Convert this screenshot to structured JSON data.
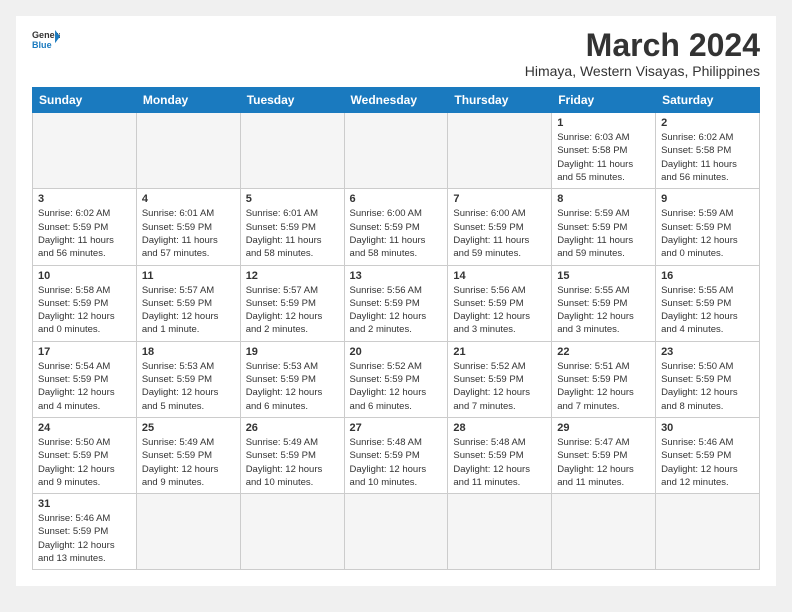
{
  "header": {
    "logo_general": "General",
    "logo_blue": "Blue",
    "title": "March 2024",
    "subtitle": "Himaya, Western Visayas, Philippines"
  },
  "weekdays": [
    "Sunday",
    "Monday",
    "Tuesday",
    "Wednesday",
    "Thursday",
    "Friday",
    "Saturday"
  ],
  "weeks": [
    [
      {
        "day": "",
        "info": ""
      },
      {
        "day": "",
        "info": ""
      },
      {
        "day": "",
        "info": ""
      },
      {
        "day": "",
        "info": ""
      },
      {
        "day": "",
        "info": ""
      },
      {
        "day": "1",
        "info": "Sunrise: 6:03 AM\nSunset: 5:58 PM\nDaylight: 11 hours\nand 55 minutes."
      },
      {
        "day": "2",
        "info": "Sunrise: 6:02 AM\nSunset: 5:58 PM\nDaylight: 11 hours\nand 56 minutes."
      }
    ],
    [
      {
        "day": "3",
        "info": "Sunrise: 6:02 AM\nSunset: 5:59 PM\nDaylight: 11 hours\nand 56 minutes."
      },
      {
        "day": "4",
        "info": "Sunrise: 6:01 AM\nSunset: 5:59 PM\nDaylight: 11 hours\nand 57 minutes."
      },
      {
        "day": "5",
        "info": "Sunrise: 6:01 AM\nSunset: 5:59 PM\nDaylight: 11 hours\nand 58 minutes."
      },
      {
        "day": "6",
        "info": "Sunrise: 6:00 AM\nSunset: 5:59 PM\nDaylight: 11 hours\nand 58 minutes."
      },
      {
        "day": "7",
        "info": "Sunrise: 6:00 AM\nSunset: 5:59 PM\nDaylight: 11 hours\nand 59 minutes."
      },
      {
        "day": "8",
        "info": "Sunrise: 5:59 AM\nSunset: 5:59 PM\nDaylight: 11 hours\nand 59 minutes."
      },
      {
        "day": "9",
        "info": "Sunrise: 5:59 AM\nSunset: 5:59 PM\nDaylight: 12 hours\nand 0 minutes."
      }
    ],
    [
      {
        "day": "10",
        "info": "Sunrise: 5:58 AM\nSunset: 5:59 PM\nDaylight: 12 hours\nand 0 minutes."
      },
      {
        "day": "11",
        "info": "Sunrise: 5:57 AM\nSunset: 5:59 PM\nDaylight: 12 hours\nand 1 minute."
      },
      {
        "day": "12",
        "info": "Sunrise: 5:57 AM\nSunset: 5:59 PM\nDaylight: 12 hours\nand 2 minutes."
      },
      {
        "day": "13",
        "info": "Sunrise: 5:56 AM\nSunset: 5:59 PM\nDaylight: 12 hours\nand 2 minutes."
      },
      {
        "day": "14",
        "info": "Sunrise: 5:56 AM\nSunset: 5:59 PM\nDaylight: 12 hours\nand 3 minutes."
      },
      {
        "day": "15",
        "info": "Sunrise: 5:55 AM\nSunset: 5:59 PM\nDaylight: 12 hours\nand 3 minutes."
      },
      {
        "day": "16",
        "info": "Sunrise: 5:55 AM\nSunset: 5:59 PM\nDaylight: 12 hours\nand 4 minutes."
      }
    ],
    [
      {
        "day": "17",
        "info": "Sunrise: 5:54 AM\nSunset: 5:59 PM\nDaylight: 12 hours\nand 4 minutes."
      },
      {
        "day": "18",
        "info": "Sunrise: 5:53 AM\nSunset: 5:59 PM\nDaylight: 12 hours\nand 5 minutes."
      },
      {
        "day": "19",
        "info": "Sunrise: 5:53 AM\nSunset: 5:59 PM\nDaylight: 12 hours\nand 6 minutes."
      },
      {
        "day": "20",
        "info": "Sunrise: 5:52 AM\nSunset: 5:59 PM\nDaylight: 12 hours\nand 6 minutes."
      },
      {
        "day": "21",
        "info": "Sunrise: 5:52 AM\nSunset: 5:59 PM\nDaylight: 12 hours\nand 7 minutes."
      },
      {
        "day": "22",
        "info": "Sunrise: 5:51 AM\nSunset: 5:59 PM\nDaylight: 12 hours\nand 7 minutes."
      },
      {
        "day": "23",
        "info": "Sunrise: 5:50 AM\nSunset: 5:59 PM\nDaylight: 12 hours\nand 8 minutes."
      }
    ],
    [
      {
        "day": "24",
        "info": "Sunrise: 5:50 AM\nSunset: 5:59 PM\nDaylight: 12 hours\nand 9 minutes."
      },
      {
        "day": "25",
        "info": "Sunrise: 5:49 AM\nSunset: 5:59 PM\nDaylight: 12 hours\nand 9 minutes."
      },
      {
        "day": "26",
        "info": "Sunrise: 5:49 AM\nSunset: 5:59 PM\nDaylight: 12 hours\nand 10 minutes."
      },
      {
        "day": "27",
        "info": "Sunrise: 5:48 AM\nSunset: 5:59 PM\nDaylight: 12 hours\nand 10 minutes."
      },
      {
        "day": "28",
        "info": "Sunrise: 5:48 AM\nSunset: 5:59 PM\nDaylight: 12 hours\nand 11 minutes."
      },
      {
        "day": "29",
        "info": "Sunrise: 5:47 AM\nSunset: 5:59 PM\nDaylight: 12 hours\nand 11 minutes."
      },
      {
        "day": "30",
        "info": "Sunrise: 5:46 AM\nSunset: 5:59 PM\nDaylight: 12 hours\nand 12 minutes."
      }
    ],
    [
      {
        "day": "31",
        "info": "Sunrise: 5:46 AM\nSunset: 5:59 PM\nDaylight: 12 hours\nand 13 minutes."
      },
      {
        "day": "",
        "info": ""
      },
      {
        "day": "",
        "info": ""
      },
      {
        "day": "",
        "info": ""
      },
      {
        "day": "",
        "info": ""
      },
      {
        "day": "",
        "info": ""
      },
      {
        "day": "",
        "info": ""
      }
    ]
  ]
}
